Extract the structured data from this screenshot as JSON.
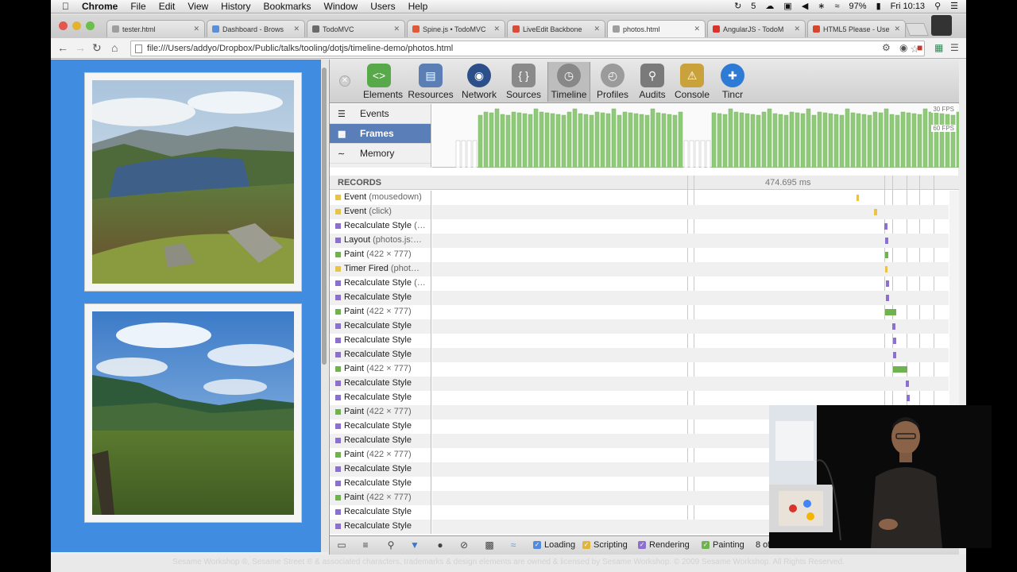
{
  "menubar": {
    "app": "Chrome",
    "items": [
      "File",
      "Edit",
      "View",
      "History",
      "Bookmarks",
      "Window",
      "Users",
      "Help"
    ],
    "status_text": "5",
    "battery": "97%",
    "clock": "Fri 10:13"
  },
  "tabs": [
    {
      "title": "tester.html",
      "color": "#9e9e9e"
    },
    {
      "title": "Dashboard - Brows",
      "color": "#5b8fd9"
    },
    {
      "title": "TodoMVC",
      "color": "#6a6a6a"
    },
    {
      "title": "Spine.js • TodoMVC",
      "color": "#e05a3a"
    },
    {
      "title": "LiveEdit Backbone",
      "color": "#d94c3a"
    },
    {
      "title": "photos.html",
      "color": "#9e9e9e"
    },
    {
      "title": "AngularJS - TodoM",
      "color": "#d9332b"
    },
    {
      "title": "HTML5 Please - Use",
      "color": "#d6462c"
    }
  ],
  "address": {
    "url": "file:///Users/addyo/Dropbox/Public/talks/tooling/dotjs/timeline-demo/photos.html"
  },
  "devtools": {
    "panels": [
      {
        "label": "Elements",
        "icon": "elements-icon",
        "color": "#58a94a"
      },
      {
        "label": "Resources",
        "icon": "resources-icon",
        "color": "#5b7fb4"
      },
      {
        "label": "Network",
        "icon": "network-icon",
        "color": "#2c4f8a"
      },
      {
        "label": "Sources",
        "icon": "sources-icon",
        "color": "#8a8a8a"
      },
      {
        "label": "Timeline",
        "icon": "timeline-icon",
        "color": "#888888"
      },
      {
        "label": "Profiles",
        "icon": "profiles-icon",
        "color": "#9b9b9b"
      },
      {
        "label": "Audits",
        "icon": "audits-icon",
        "color": "#7a7a7a"
      },
      {
        "label": "Console",
        "icon": "console-icon",
        "color": "#c9a23b"
      },
      {
        "label": "Tincr",
        "icon": "tincr-icon",
        "color": "#2e7bd6"
      }
    ],
    "active_panel": "Timeline",
    "overview_items": [
      {
        "label": "Events",
        "icon": "events-icon"
      },
      {
        "label": "Frames",
        "icon": "frames-icon"
      },
      {
        "label": "Memory",
        "icon": "memory-icon"
      }
    ],
    "fps_labels": [
      "30 FPS",
      "60 FPS"
    ],
    "records_header": "RECORDS",
    "duration": "474.695 ms",
    "records": [
      {
        "name": "Event",
        "detail": "(mousedown)",
        "color": "#e8c34a"
      },
      {
        "name": "Event",
        "detail": "(click)",
        "color": "#e8c34a"
      },
      {
        "name": "Recalculate Style",
        "detail": "(…",
        "color": "#8b6fd1"
      },
      {
        "name": "Layout",
        "detail": "(photos.js:…",
        "color": "#8b6fd1"
      },
      {
        "name": "Paint",
        "detail": "(422 × 777)",
        "color": "#6fb34f"
      },
      {
        "name": "Timer Fired",
        "detail": "(phot…",
        "color": "#e8c34a"
      },
      {
        "name": "Recalculate Style",
        "detail": "(…",
        "color": "#8b6fd1"
      },
      {
        "name": "Recalculate Style",
        "detail": "",
        "color": "#8b6fd1"
      },
      {
        "name": "Paint",
        "detail": "(422 × 777)",
        "color": "#6fb34f"
      },
      {
        "name": "Recalculate Style",
        "detail": "",
        "color": "#8b6fd1"
      },
      {
        "name": "Recalculate Style",
        "detail": "",
        "color": "#8b6fd1"
      },
      {
        "name": "Recalculate Style",
        "detail": "",
        "color": "#8b6fd1"
      },
      {
        "name": "Paint",
        "detail": "(422 × 777)",
        "color": "#6fb34f"
      },
      {
        "name": "Recalculate Style",
        "detail": "",
        "color": "#8b6fd1"
      },
      {
        "name": "Recalculate Style",
        "detail": "",
        "color": "#8b6fd1"
      },
      {
        "name": "Paint",
        "detail": "(422 × 777)",
        "color": "#6fb34f"
      },
      {
        "name": "Recalculate Style",
        "detail": "",
        "color": "#8b6fd1"
      },
      {
        "name": "Recalculate Style",
        "detail": "",
        "color": "#8b6fd1"
      },
      {
        "name": "Paint",
        "detail": "(422 × 777)",
        "color": "#6fb34f"
      },
      {
        "name": "Recalculate Style",
        "detail": "",
        "color": "#8b6fd1"
      },
      {
        "name": "Recalculate Style",
        "detail": "",
        "color": "#8b6fd1"
      },
      {
        "name": "Paint",
        "detail": "(422 × 777)",
        "color": "#6fb34f"
      },
      {
        "name": "Recalculate Style",
        "detail": "",
        "color": "#8b6fd1"
      },
      {
        "name": "Recalculate Style",
        "detail": "",
        "color": "#8b6fd1"
      }
    ],
    "categories": [
      {
        "label": "Loading",
        "color": "#4f8be0"
      },
      {
        "label": "Scripting",
        "color": "#e0b53a"
      },
      {
        "label": "Rendering",
        "color": "#8b6fd1"
      },
      {
        "label": "Painting",
        "color": "#6fb34f"
      }
    ],
    "status_text": "8 of 74 frames shown"
  },
  "watermark": "Sesame Workshop ®, Sesame Street ® & associated characters, trademarks & design elements are owned & licensed by Sesame Workshop. © 2009 Sesame Workshop. All Rights Reserved."
}
